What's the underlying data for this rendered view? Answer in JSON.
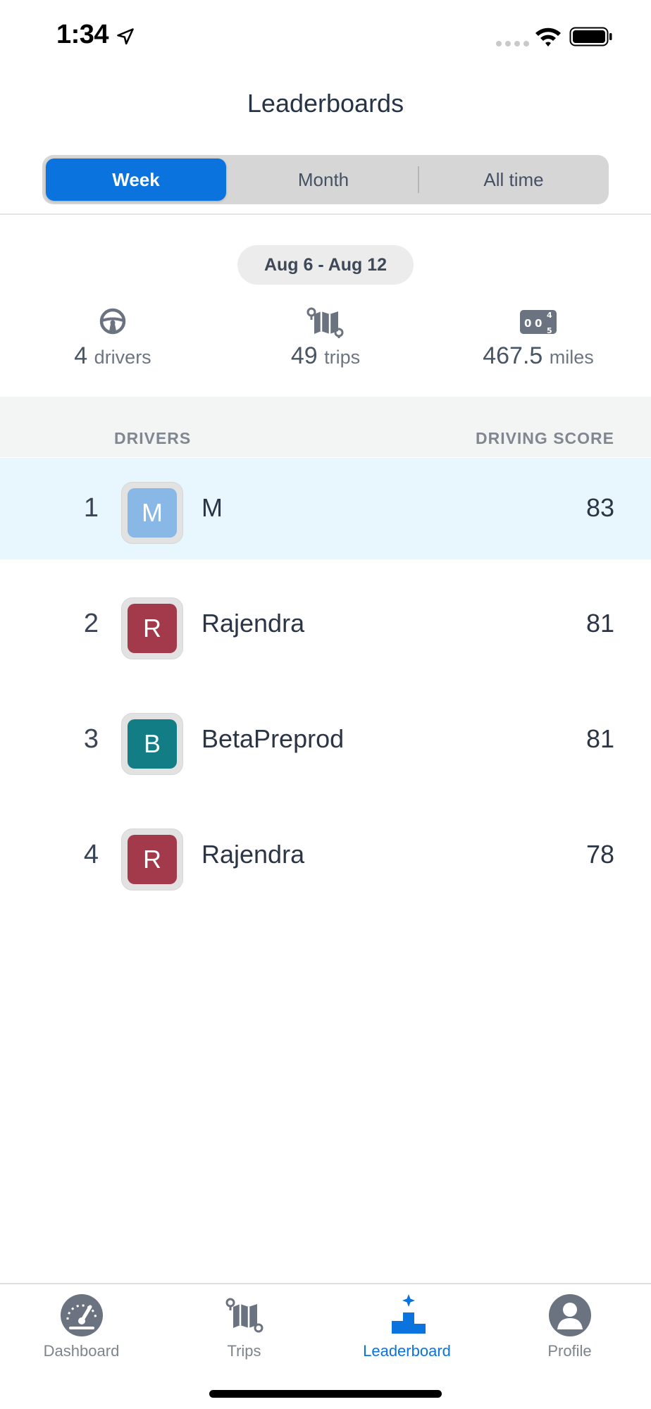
{
  "status_bar": {
    "time": "1:34",
    "icons": [
      "location-arrow-icon",
      "cellular-signal-icon",
      "wifi-icon",
      "battery-icon"
    ]
  },
  "header": {
    "title": "Leaderboards"
  },
  "period_tabs": [
    {
      "label": "Week",
      "selected": true
    },
    {
      "label": "Month",
      "selected": false
    },
    {
      "label": "All time",
      "selected": false
    }
  ],
  "date_range": "Aug 6 - Aug 12",
  "stats": [
    {
      "icon": "steering-wheel-icon",
      "value": "4",
      "unit": "drivers"
    },
    {
      "icon": "map-icon",
      "value": "49",
      "unit": "trips"
    },
    {
      "icon": "odometer-icon",
      "value": "467.5",
      "unit": "miles"
    }
  ],
  "table": {
    "col_drivers": "DRIVERS",
    "col_score": "DRIVING SCORE",
    "rows": [
      {
        "rank": "1",
        "initial": "M",
        "name": "M",
        "score": "83",
        "avatar_color": "#8ab8e6",
        "highlighted": true
      },
      {
        "rank": "2",
        "initial": "R",
        "name": "Rajendra",
        "score": "81",
        "avatar_color": "#a23a4b",
        "highlighted": false
      },
      {
        "rank": "3",
        "initial": "B",
        "name": "BetaPreprod",
        "score": "81",
        "avatar_color": "#137d85",
        "highlighted": false
      },
      {
        "rank": "4",
        "initial": "R",
        "name": "Rajendra",
        "score": "78",
        "avatar_color": "#a23a4b",
        "highlighted": false
      }
    ]
  },
  "tab_bar": [
    {
      "label": "Dashboard",
      "icon": "speedometer-icon",
      "active": false
    },
    {
      "label": "Trips",
      "icon": "map-icon",
      "active": false
    },
    {
      "label": "Leaderboard",
      "icon": "podium-icon",
      "active": true
    },
    {
      "label": "Profile",
      "icon": "person-icon",
      "active": false
    }
  ],
  "colors": {
    "accent": "#0a73dd",
    "highlight_row": "#e8f7fd",
    "icon_gray": "#6b7380"
  }
}
